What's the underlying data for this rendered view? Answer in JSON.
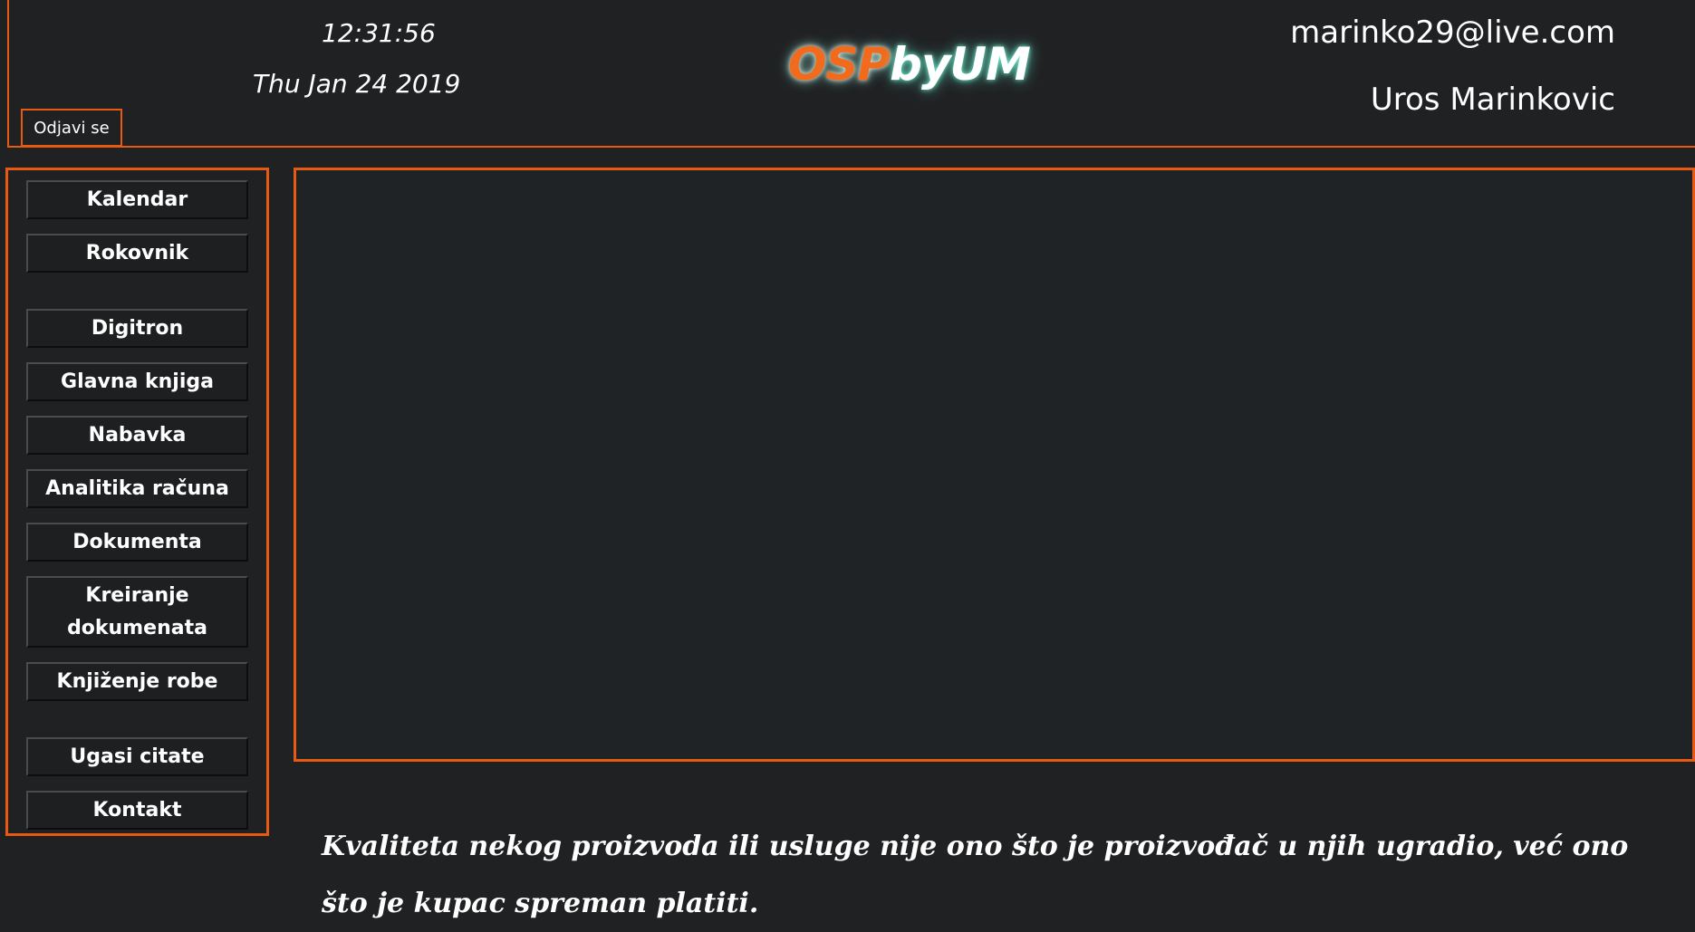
{
  "header": {
    "time": "12:31:56",
    "date": "Thu Jan 24 2019",
    "logout_label": "Odjavi se",
    "logo_part_a": "OSP",
    "logo_part_b": "byUM",
    "user_email": "marinko29@live.com",
    "user_name": "Uros Marinkovic"
  },
  "sidebar": {
    "items": [
      {
        "label": "Kalendar"
      },
      {
        "label": "Rokovnik"
      },
      {
        "label": "Digitron"
      },
      {
        "label": "Glavna knjiga"
      },
      {
        "label": "Nabavka"
      },
      {
        "label": "Analitika računa"
      },
      {
        "label": "Dokumenta"
      },
      {
        "label": "Kreiranje dokumenata"
      },
      {
        "label": "Knjiženje robe"
      },
      {
        "label": "Ugasi citate"
      },
      {
        "label": "Kontakt"
      }
    ]
  },
  "quote": {
    "text": "Kvaliteta nekog proizvoda ili usluge nije ono što je proizvođač u njih ugradio, već ono što je kupac spreman platiti."
  },
  "colors": {
    "accent": "#e85a12",
    "background": "#202123",
    "logo_orange": "#f26a1b",
    "logo_glow": "#78ffdc"
  }
}
